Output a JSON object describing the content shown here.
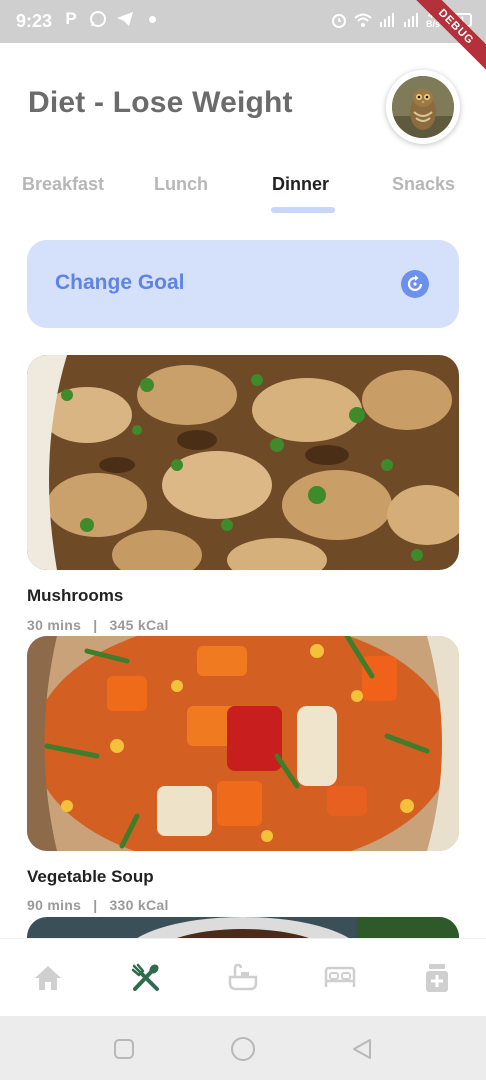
{
  "status_bar": {
    "time": "9:23",
    "net_speed_value": "47",
    "net_speed_unit": "B/s",
    "battery": "24",
    "debug_banner": "DEBUG",
    "icons": [
      "p-icon",
      "whatsapp-icon",
      "telegram-icon",
      "dot-icon",
      "alarm-icon",
      "wifi-icon",
      "signal-icon",
      "signal-icon",
      "battery-icon"
    ]
  },
  "header": {
    "title": "Diet - Lose Weight",
    "avatar": "owl-avatar"
  },
  "tabs": [
    {
      "label": "Breakfast",
      "active": false
    },
    {
      "label": "Lunch",
      "active": false
    },
    {
      "label": "Dinner",
      "active": true
    },
    {
      "label": "Snacks",
      "active": false
    }
  ],
  "goal": {
    "label": "Change Goal",
    "icon": "refresh-icon",
    "accent": "#5d84e6",
    "background": "#d5e0fb"
  },
  "recipes": [
    {
      "name": "Mushrooms",
      "duration": "30 mins",
      "separator": "|",
      "calories": "345 kCal"
    },
    {
      "name": "Vegetable Soup",
      "duration": "90 mins",
      "separator": "|",
      "calories": "330 kCal"
    },
    {
      "name": "",
      "duration": "",
      "separator": "",
      "calories": ""
    }
  ],
  "bottom_nav": [
    {
      "icon": "home-icon",
      "active": false
    },
    {
      "icon": "fork-spoon-icon",
      "active": true
    },
    {
      "icon": "bath-icon",
      "active": false
    },
    {
      "icon": "bed-icon",
      "active": false
    },
    {
      "icon": "medicine-icon",
      "active": false
    }
  ],
  "colors": {
    "active_nav": "#2f6b4f",
    "inactive_nav": "#cfcfcf",
    "title": "#6b6b6b"
  }
}
